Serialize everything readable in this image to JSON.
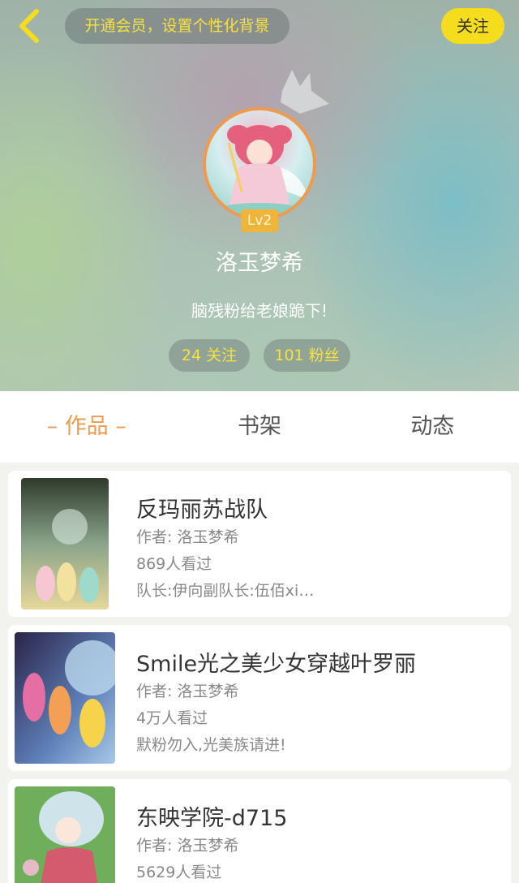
{
  "header": {
    "vip_text": "开通会员，设置个性化背景",
    "follow_label": "关注",
    "level": "Lv2",
    "username": "洛玉梦希",
    "bio": "脑残粉给老娘跪下!",
    "following": {
      "count": "24",
      "label": "关注"
    },
    "fans": {
      "count": "101",
      "label": "粉丝"
    }
  },
  "tabs": [
    {
      "label": "作品",
      "active": true
    },
    {
      "label": "书架",
      "active": false
    },
    {
      "label": "动态",
      "active": false
    }
  ],
  "works": [
    {
      "title": "反玛丽苏战队",
      "author": "作者: 洛玉梦希",
      "views": "869人看过",
      "desc": "队长:伊向副队长:伍佰xi…"
    },
    {
      "title": "Smile光之美少女穿越叶罗丽",
      "author": "作者: 洛玉梦希",
      "views": "4万人看过",
      "desc": "默粉勿入,光美族请进!"
    },
    {
      "title": "东映学院-d715",
      "author": "作者: 洛玉梦希",
      "views": "5629人看过",
      "desc": ""
    }
  ],
  "colors": {
    "accent": "#ef9a4e",
    "yellow": "#f5dd1e",
    "badge": "#efb43c"
  }
}
